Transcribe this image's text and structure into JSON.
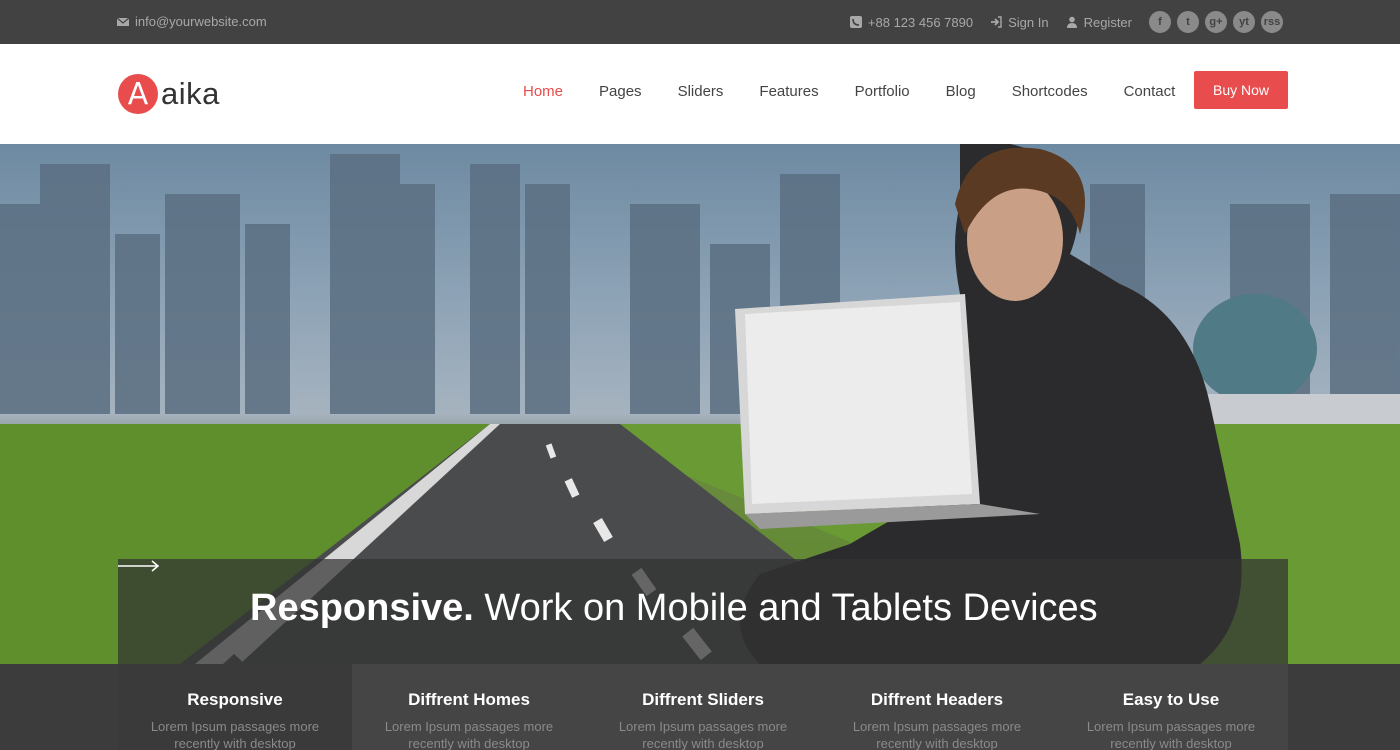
{
  "topbar": {
    "email": "info@yourwebsite.com",
    "phone": "+88 123 456 7890",
    "sign_in": "Sign In",
    "register": "Register",
    "socials": [
      "f",
      "t",
      "g+",
      "yt",
      "rss"
    ]
  },
  "header": {
    "logo_letter": "A",
    "logo_text": "aika",
    "nav": [
      "Home",
      "Pages",
      "Sliders",
      "Features",
      "Portfolio",
      "Blog",
      "Shortcodes",
      "Contact"
    ],
    "active_nav": "Home",
    "buy_label": "Buy Now"
  },
  "hero": {
    "caption_bold": "Responsive.",
    "caption_light": " Work on Mobile and Tablets Devices"
  },
  "features": [
    {
      "title": "Responsive",
      "desc": "Lorem Ipsum passages more recently with desktop"
    },
    {
      "title": "Diffrent Homes",
      "desc": "Lorem Ipsum passages more recently with desktop"
    },
    {
      "title": "Diffrent Sliders",
      "desc": "Lorem Ipsum passages more recently with desktop"
    },
    {
      "title": "Diffrent Headers",
      "desc": "Lorem Ipsum passages more recently with desktop"
    },
    {
      "title": "Easy to Use",
      "desc": "Lorem Ipsum passages more recently with desktop"
    }
  ],
  "colors": {
    "accent": "#e84c4c",
    "topbar_bg": "#424242",
    "feature_bg": "#454545"
  }
}
